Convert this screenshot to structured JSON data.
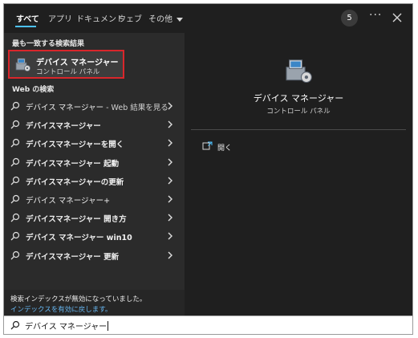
{
  "tabs": [
    {
      "label": "すべて",
      "active": true
    },
    {
      "label": "アプリ"
    },
    {
      "label": "ドキュメント"
    },
    {
      "label": "ウェブ"
    },
    {
      "label": "その他"
    }
  ],
  "header": {
    "badge": "5",
    "more": "···"
  },
  "best_match": {
    "heading": "最も一致する検索結果",
    "name": "デバイス マネージャー",
    "subtitle": "コントロール パネル",
    "icon": "device-manager-icon"
  },
  "web": {
    "heading": "Web の検索",
    "items": [
      {
        "main": "デバイス マネージャー",
        "suffix": " - Web 結果を見る"
      },
      {
        "main": "デバイスマネージャー",
        "suffix": ""
      },
      {
        "main": "デバイスマネージャーを開く",
        "suffix": ""
      },
      {
        "main": "デバイスマネージャー 起動",
        "suffix": ""
      },
      {
        "main": "デバイスマネージャーの更新",
        "suffix": ""
      },
      {
        "main": "デバイス マネージャー+",
        "suffix": ""
      },
      {
        "main": "デバイスマネージャー 開き方",
        "suffix": ""
      },
      {
        "main": "デバイス マネージャー win10",
        "suffix": ""
      },
      {
        "main": "デバイスマネージャー 更新",
        "suffix": ""
      }
    ]
  },
  "footer": {
    "message": "検索インデックスが無効になっていました。",
    "link": "インデックスを有効に戻します。"
  },
  "detail": {
    "title": "デバイス マネージャー",
    "subtitle": "コントロール パネル",
    "action_open": "開く"
  },
  "search": {
    "value": "デバイス マネージャー"
  },
  "colors": {
    "accent": "#4cc2ff",
    "highlight": "#d9262b",
    "link": "#67b7f2"
  }
}
